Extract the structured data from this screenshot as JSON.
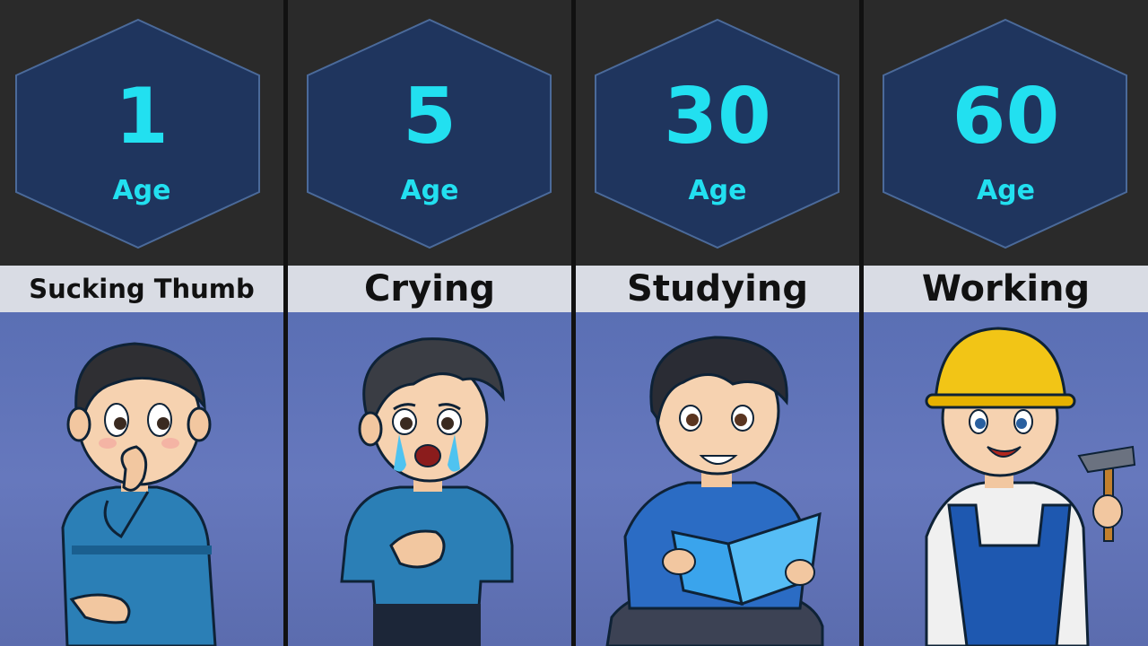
{
  "panels": [
    {
      "age_number": "1",
      "age_word": "Age",
      "activity": "Sucking Thumb",
      "illustration": "boy-sucking-thumb"
    },
    {
      "age_number": "5",
      "age_word": "Age",
      "activity": "Crying",
      "illustration": "boy-crying"
    },
    {
      "age_number": "30",
      "age_word": "Age",
      "activity": "Studying",
      "illustration": "boy-reading-book"
    },
    {
      "age_number": "60",
      "age_word": "Age",
      "activity": "Working",
      "illustration": "worker-with-hammer"
    }
  ],
  "colors": {
    "number": "#22e0f0",
    "hexagon_fill": "#1f355e",
    "top_bg": "#2a2a2a",
    "label_bg": "#d9dce4",
    "scene_bg": "#5f72b8"
  }
}
